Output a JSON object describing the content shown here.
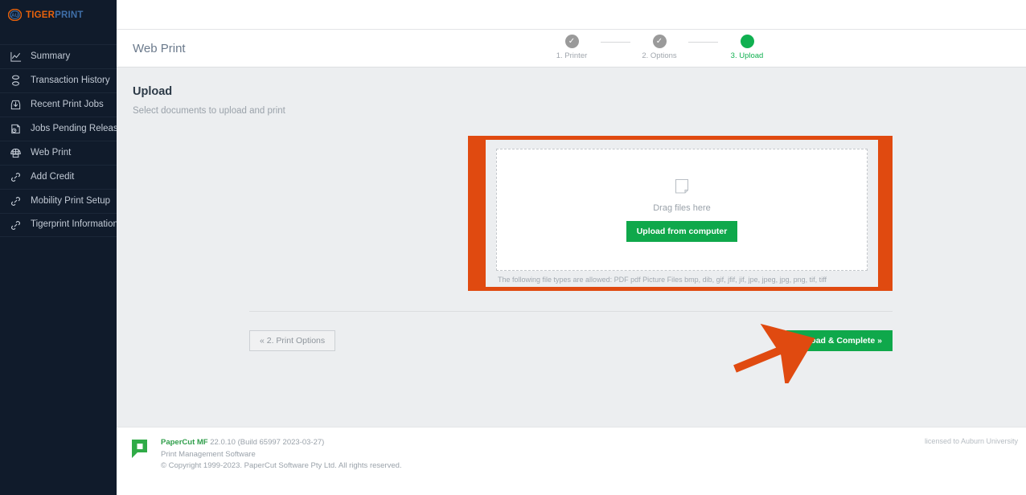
{
  "brand": {
    "name_primary": "TIGER",
    "name_secondary": "PRINT",
    "mark": "au-logo-icon"
  },
  "sidebar": {
    "items": [
      {
        "label": "Summary",
        "icon": "chart-line-icon"
      },
      {
        "label": "Transaction History",
        "icon": "hourglass-icon"
      },
      {
        "label": "Recent Print Jobs",
        "icon": "inbox-tray-icon"
      },
      {
        "label": "Jobs Pending Release",
        "icon": "document-clock-icon"
      },
      {
        "label": "Web Print",
        "icon": "printer-icon"
      },
      {
        "label": "Add Credit",
        "icon": "link-icon"
      },
      {
        "label": "Mobility Print Setup",
        "icon": "link-icon"
      },
      {
        "label": "Tigerprint Information",
        "icon": "link-icon"
      }
    ]
  },
  "header": {
    "title": "Web Print"
  },
  "stepper": {
    "steps": [
      {
        "label": "1. Printer",
        "state": "done",
        "glyph": "✓"
      },
      {
        "label": "2. Options",
        "state": "done",
        "glyph": "✓"
      },
      {
        "label": "3. Upload",
        "state": "active",
        "glyph": ""
      }
    ]
  },
  "upload": {
    "title": "Upload",
    "subtitle": "Select documents to upload and print",
    "drop_text": "Drag files here",
    "drop_icon": "document-page-icon",
    "upload_button": "Upload from computer",
    "file_types": "The following file types are allowed: PDF pdf Picture Files bmp, dib, gif, jfif, jif, jpe, jpeg, jpg, png, tif, tiff"
  },
  "actions": {
    "back_label": "« 2. Print Options",
    "complete_label": "Upload & Complete »"
  },
  "annotation": {
    "arrow": "arrow-pointing-upper-right",
    "highlight_color": "#e04a10"
  },
  "footer": {
    "product": "PaperCut MF",
    "version": "22.0.10 (Build 65997 2023-03-27)",
    "tagline": "Print Management Software",
    "copyright": "© Copyright 1999-2023. PaperCut Software Pty Ltd. All rights reserved.",
    "license": "licensed to Auburn University",
    "logo": "papercut-logo-icon"
  },
  "colors": {
    "sidebar_bg": "#101b2b",
    "brand_orange": "#e8620c",
    "brand_blue": "#3f6fa8",
    "accent_green": "#0fa84b",
    "annotation_orange": "#e04a10",
    "page_bg": "#eceef0"
  }
}
